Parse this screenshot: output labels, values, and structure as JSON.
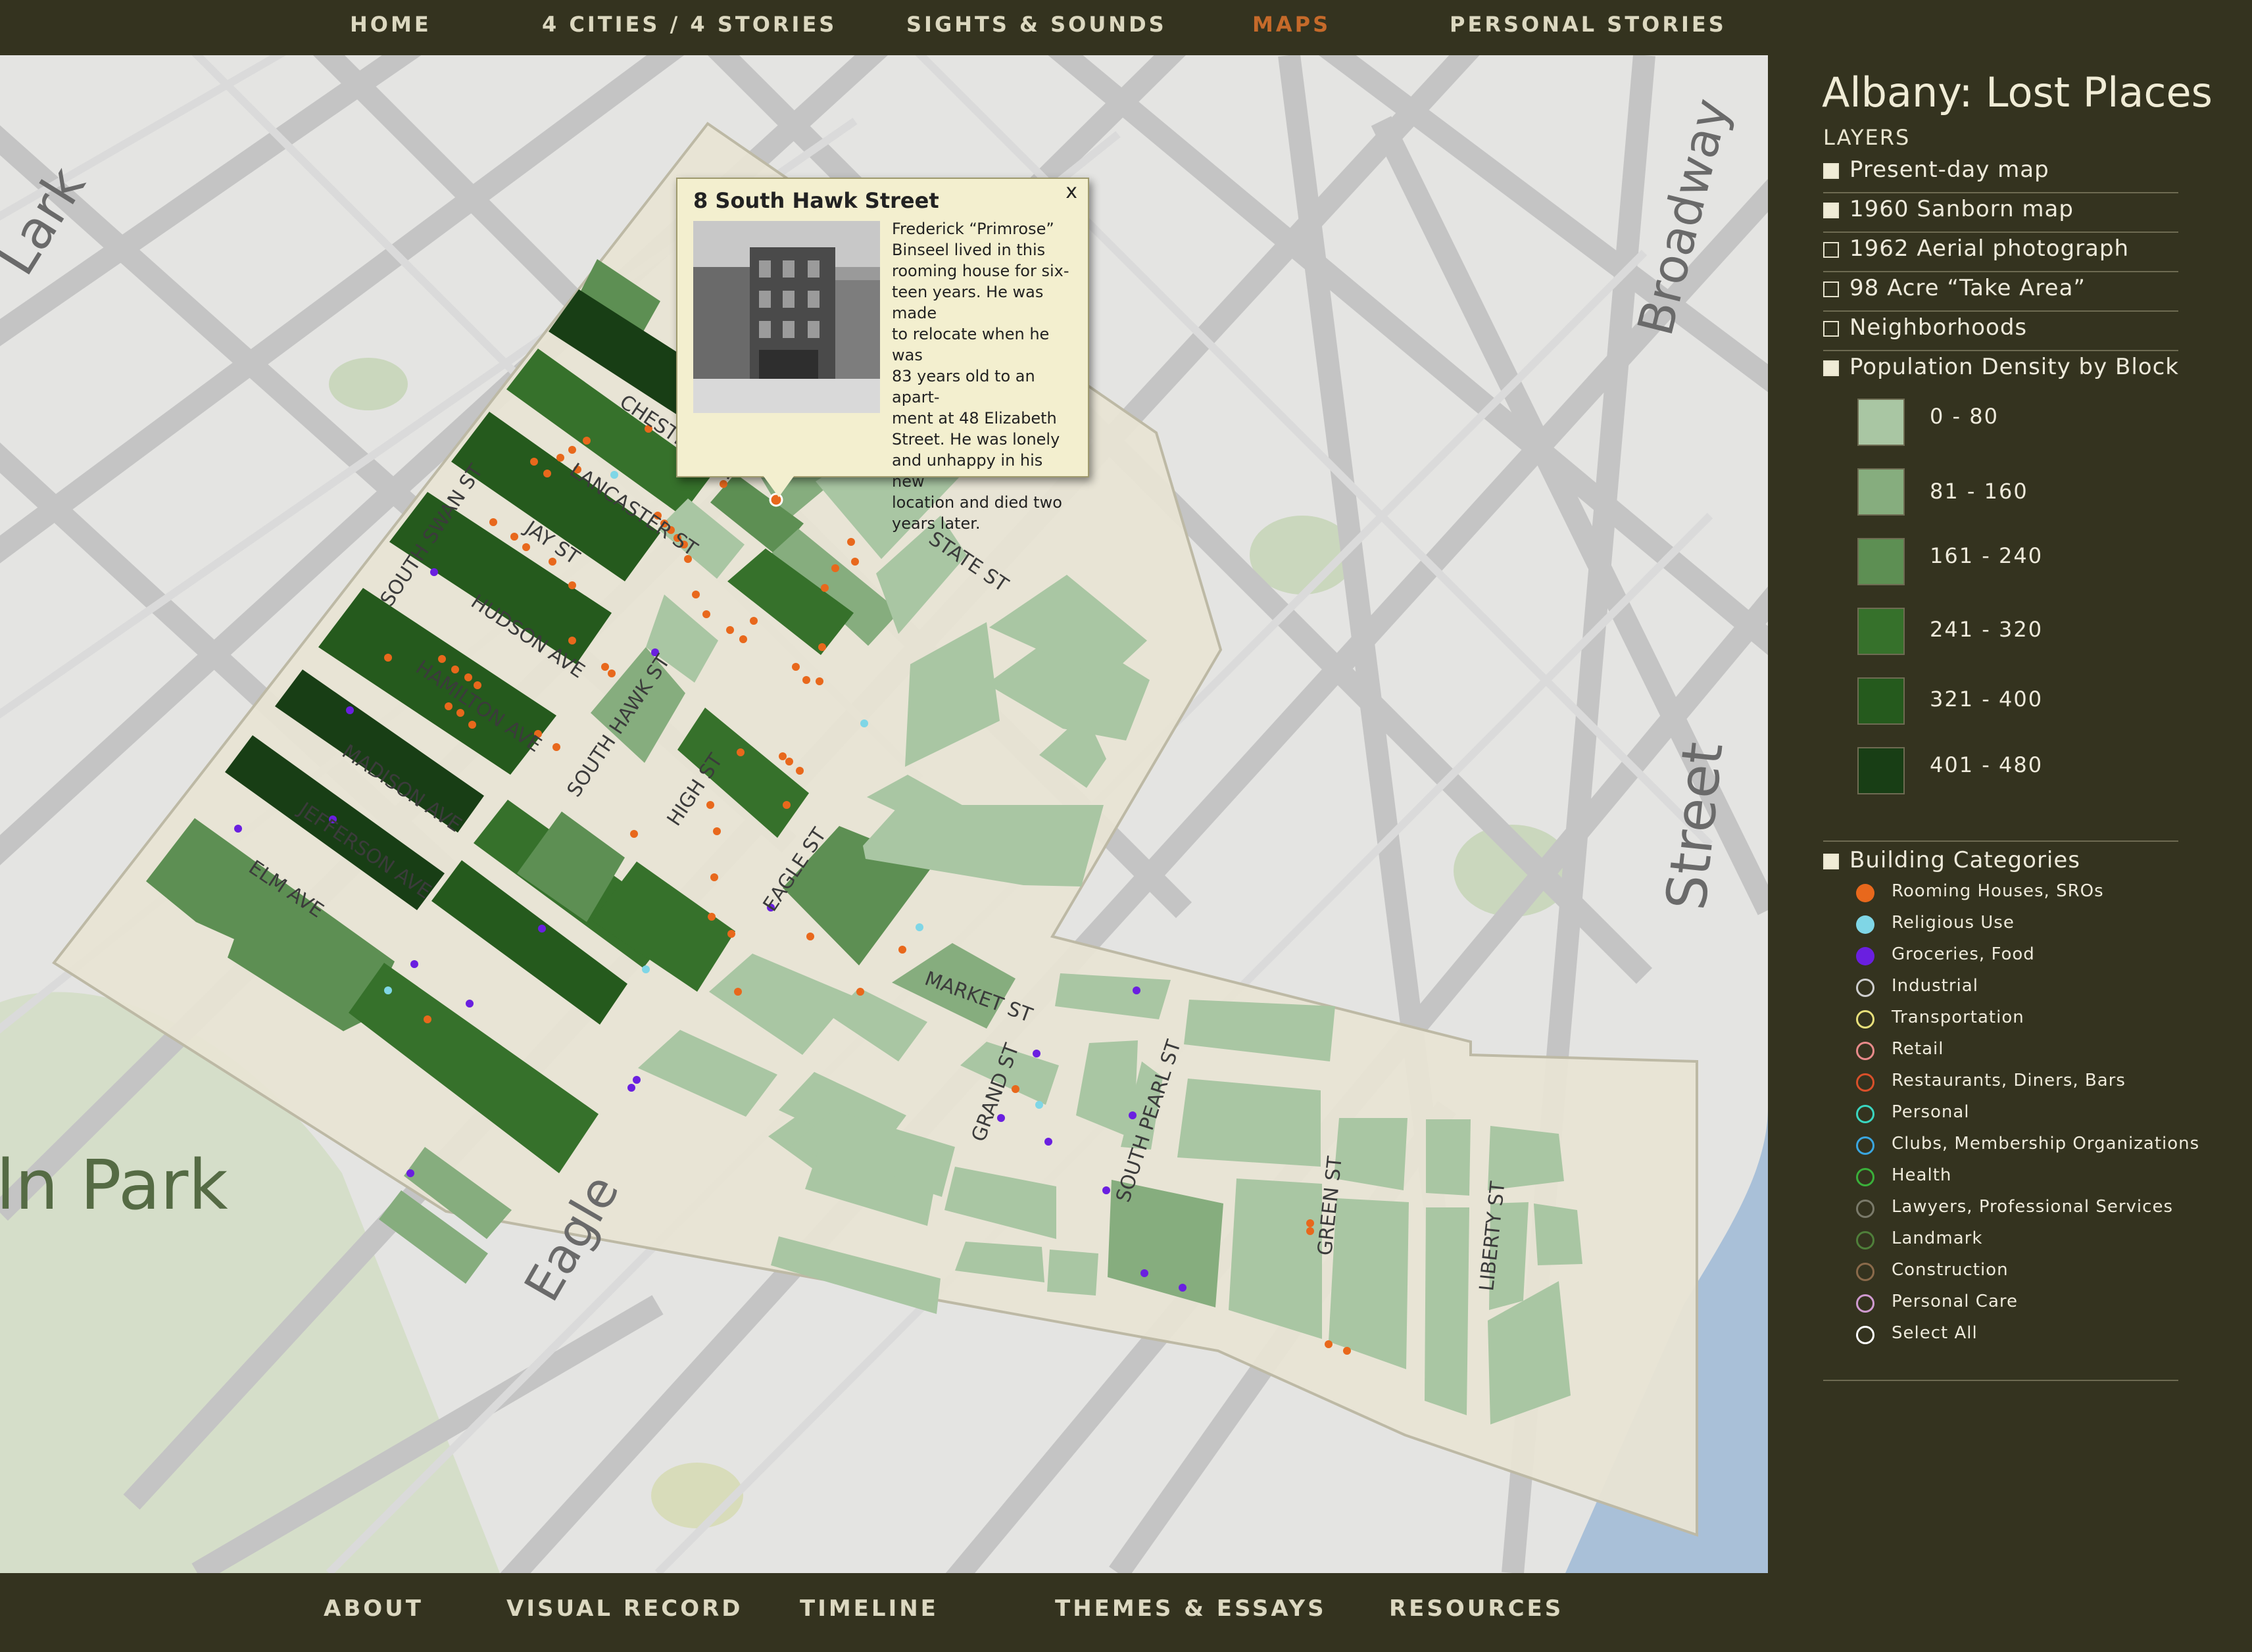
{
  "nav": {
    "home": "HOME",
    "cities": "4 CITIES / 4 STORIES",
    "sights": "SIGHTS & SOUNDS",
    "maps": "MAPS",
    "personal": "PERSONAL STORIES"
  },
  "footer": {
    "about": "ABOUT",
    "visual": "VISUAL RECORD",
    "timeline": "TIMELINE",
    "themes": "THEMES & ESSAYS",
    "resources": "RESOURCES"
  },
  "sidebar": {
    "title": "Albany: Lost Places",
    "layers_heading": "LAYERS",
    "layers": [
      {
        "label": "Present-day map",
        "checked": true
      },
      {
        "label": "1960 Sanborn map",
        "checked": true
      },
      {
        "label": "1962 Aerial photograph",
        "checked": false
      },
      {
        "label": "98 Acre “Take Area”",
        "checked": false
      },
      {
        "label": "Neighborhoods",
        "checked": false
      },
      {
        "label": "Population Density by Block",
        "checked": true
      }
    ],
    "density_legend": [
      {
        "range": "0 - 80",
        "color": "#a9c6a3"
      },
      {
        "range": "81 - 160",
        "color": "#86ad7e"
      },
      {
        "range": "161 - 240",
        "color": "#5d8f53"
      },
      {
        "range": "241 - 320",
        "color": "#36712b"
      },
      {
        "range": "321 - 400",
        "color": "#255a1d"
      },
      {
        "range": "401 - 480",
        "color": "#183e15"
      }
    ],
    "categories_heading": "Building Categories",
    "categories": [
      {
        "label": "Rooming Houses, SROs",
        "color": "#e8681c",
        "filled": true
      },
      {
        "label": "Religious Use",
        "color": "#7fd6e6",
        "filled": true
      },
      {
        "label": "Groceries, Food",
        "color": "#6a1fe0",
        "filled": true
      },
      {
        "label": "Industrial",
        "color": "#cfcfcf",
        "filled": false
      },
      {
        "label": "Transportation",
        "color": "#e8e07a",
        "filled": false
      },
      {
        "label": "Retail",
        "color": "#e88a8a",
        "filled": false
      },
      {
        "label": "Restaurants, Diners, Bars",
        "color": "#d9502a",
        "filled": false
      },
      {
        "label": "Personal",
        "color": "#3ad6c0",
        "filled": false
      },
      {
        "label": "Clubs, Membership Organizations",
        "color": "#3aa6e0",
        "filled": false
      },
      {
        "label": "Health",
        "color": "#3ab03a",
        "filled": false
      },
      {
        "label": "Lawyers, Professional Services",
        "color": "#7a7a6a",
        "filled": false
      },
      {
        "label": "Landmark",
        "color": "#4f7f3a",
        "filled": false
      },
      {
        "label": "Construction",
        "color": "#8a6a4a",
        "filled": false
      },
      {
        "label": "Personal Care",
        "color": "#d09ad0",
        "filled": false
      },
      {
        "label": "Select All",
        "color": "#ffffff",
        "filled": false
      }
    ]
  },
  "popup": {
    "title": "8 South Hawk Street",
    "close": "x",
    "lines": [
      "Frederick “Primrose”",
      "Binseel lived in this",
      "rooming house for six-",
      "teen years. He was made",
      "to relocate when he was",
      "83 years old to an apart-",
      "ment at 48 Elizabeth",
      "Street. He was lonely",
      "and unhappy in his new",
      "location and died two",
      "years later."
    ]
  },
  "map_labels": {
    "park": "ln Park",
    "broadway": "Broadway",
    "street": "Street",
    "lark": "Lark",
    "eagle": "Eagle",
    "chestnut": "CHESTNUT ST",
    "lancaster": "LANCASTER ST",
    "jay": "JAY ST",
    "hudson": "HUDSON AVE",
    "hamilton": "HAMILTON AVE",
    "madison": "MADISON AVE",
    "jefferson": "JEFFERSON AVE",
    "elm": "ELM AVE",
    "south_swan": "SOUTH SWAN ST",
    "south_hawk": "SOUTH HAWK ST",
    "high": "HIGH ST",
    "eagle_st": "EAGLE ST",
    "state": "STATE ST",
    "market": "MARKET ST",
    "grand": "GRAND ST",
    "south_pearl": "SOUTH PEARL ST",
    "green": "GREEN ST",
    "liberty": "LIBERTY ST"
  }
}
